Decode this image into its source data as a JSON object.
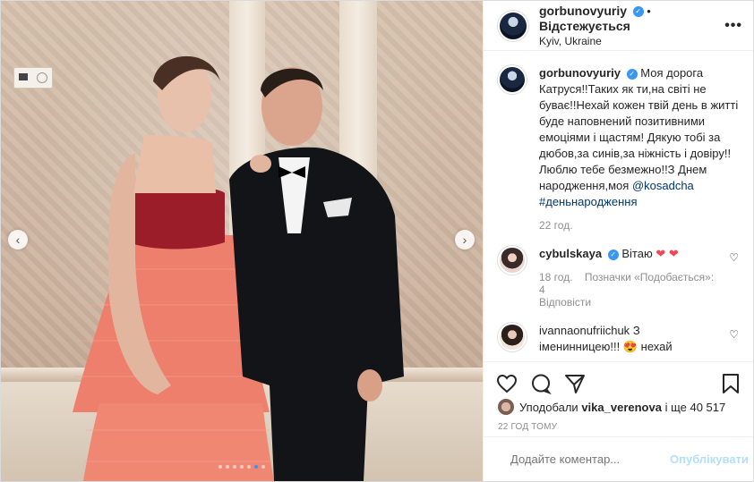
{
  "header": {
    "username": "gorbunovyuriy",
    "separator": "•",
    "follow_label": "Відстежується",
    "location": "Kyiv, Ukraine",
    "more": "•••"
  },
  "caption": {
    "username": "gorbunovyuriy",
    "text": "Моя дорога Катруся!!Таких як ти,на світі не буває!!Нехай кожен твій день в житті буде наповнений позитивними емоціями і щастям! Дякую тобі за дюбов,за синів,за ніжність і довіру!!Люблю тебе безмежно!!З Днем народження,моя",
    "mention": "@kosadcha",
    "hashtag": "#деньнародження",
    "time": "22 год."
  },
  "comments": [
    {
      "username": "cybulskaya",
      "text": "Вітаю",
      "hearts": "❤ ❤",
      "time": "18 год.",
      "likes": "Позначки «Подобається»: 4",
      "reply": "Відповісти"
    },
    {
      "username": "ivannaonufriichuk",
      "text": "З іменинницею!!!",
      "emoji": "😍",
      "tail": "нехай"
    }
  ],
  "likes": {
    "prefix": "Уподобали",
    "user": "vika_verenova",
    "suffix": "і ще 40 517"
  },
  "timestamp": "22 ГОД ТОМУ",
  "add_comment": {
    "placeholder": "Додайте коментар...",
    "post_label": "Опублікувати"
  },
  "carousel": {
    "prev": "‹",
    "next": "›",
    "dot_count": 7,
    "active_dot": 5
  },
  "colors": {
    "link_blue": "#00376b",
    "verified_blue": "#3897f0",
    "heart_red": "#ed4956",
    "post_button_disabled": "#b2dffc"
  }
}
